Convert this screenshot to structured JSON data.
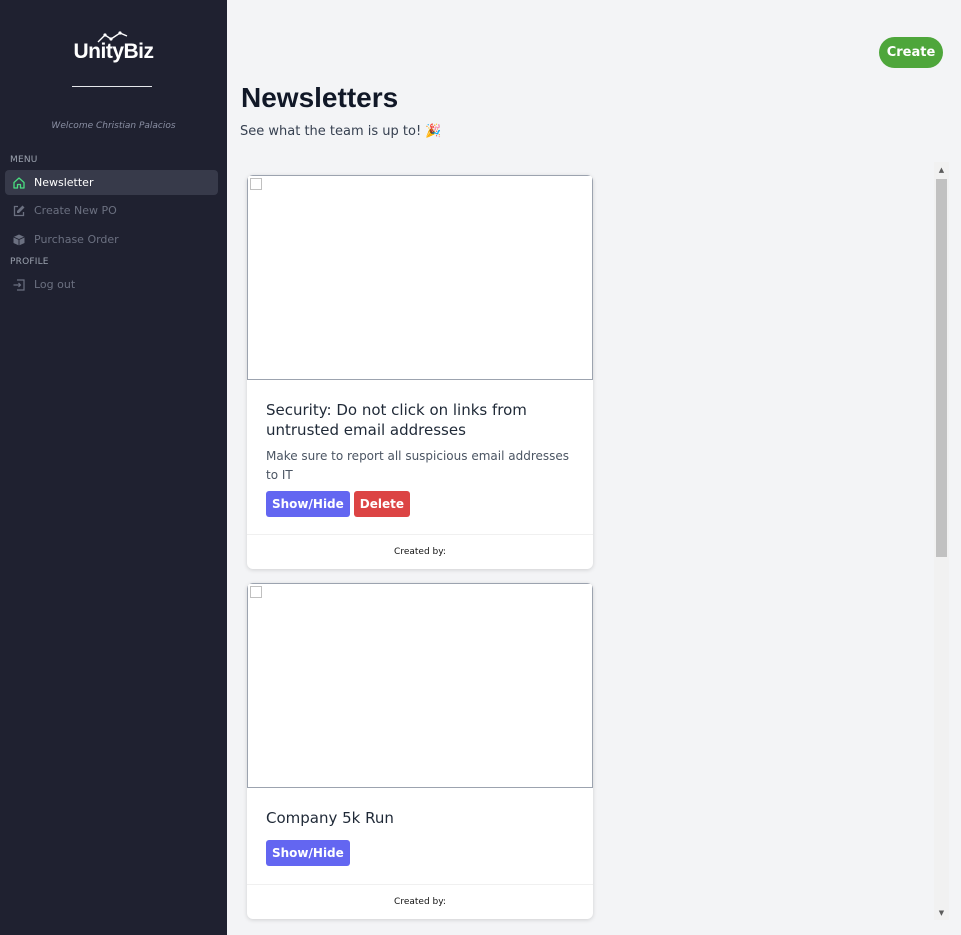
{
  "brand": {
    "name": "UnityBiz"
  },
  "sidebar": {
    "welcome": "Welcome Christian Palacios",
    "menu_label": "MENU",
    "profile_label": "PROFILE",
    "items": [
      {
        "label": "Newsletter",
        "icon": "home-icon",
        "active": true
      },
      {
        "label": "Create New PO",
        "icon": "edit-icon",
        "active": false
      },
      {
        "label": "Purchase Order",
        "icon": "box-icon",
        "active": false
      }
    ],
    "profile_items": [
      {
        "label": "Log out",
        "icon": "logout-icon"
      }
    ]
  },
  "header": {
    "create_label": "Create",
    "title": "Newsletters",
    "subtitle": "See what the team is up to! 🎉"
  },
  "newsletters": [
    {
      "title": "Security: Do not click on links from untrusted email addresses",
      "description": "Make sure to report all suspicious email addresses to IT",
      "show_hide_label": "Show/Hide",
      "delete_label": "Delete",
      "footer": "Created by:"
    },
    {
      "title": "Company 5k Run",
      "show_hide_label": "Show/Hide",
      "footer": "Created by:"
    }
  ],
  "colors": {
    "sidebar_bg": "#1f2130",
    "accent_green": "#4ea63b",
    "button_purple": "#6366f1",
    "button_red": "#dc4444"
  }
}
